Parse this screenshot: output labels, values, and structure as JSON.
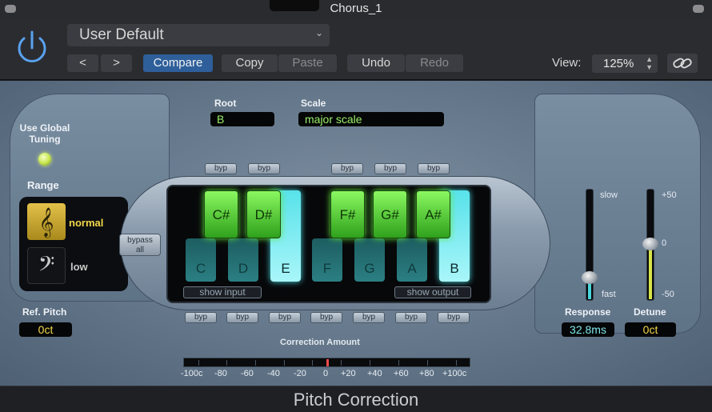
{
  "window": {
    "title": "Chorus_1"
  },
  "toolbar": {
    "preset": "User Default",
    "back_label": "<",
    "forward_label": ">",
    "compare_label": "Compare",
    "copy_label": "Copy",
    "paste_label": "Paste",
    "undo_label": "Undo",
    "redo_label": "Redo",
    "view_label": "View:",
    "zoom_value": "125%",
    "icons": {
      "power": "power-icon",
      "link": "link-icon",
      "dropdown": "chevron-down-icon"
    }
  },
  "plugin": {
    "name": "Pitch Correction",
    "root_label": "Root",
    "root_value": "B",
    "scale_label": "Scale",
    "scale_value": "major scale",
    "global_tuning_line1": "Use Global",
    "global_tuning_line2": "Tuning",
    "global_tuning_on": true,
    "range_label": "Range",
    "range_normal": "normal",
    "range_low": "low",
    "range_selected": "normal",
    "treble_clef": "𝄞",
    "bass_clef": "𝄢",
    "ref_pitch_label": "Ref. Pitch",
    "ref_pitch_value": "0ct",
    "bypass_all_line1": "bypass",
    "bypass_all_line2": "all",
    "bypass_label": "byp",
    "show_input": "show input",
    "show_output": "show output",
    "keys_white": [
      "C",
      "D",
      "E",
      "F",
      "G",
      "A",
      "B"
    ],
    "keys_black": [
      "C#",
      "D#",
      "F#",
      "G#",
      "A#"
    ],
    "lit_white_keys": [
      "E",
      "B"
    ],
    "correction_amount_label": "Correction Amount",
    "correction_scale": [
      "-100c",
      "-80",
      "-60",
      "-40",
      "-20",
      "0",
      "+20",
      "+40",
      "+60",
      "+80",
      "+100c"
    ],
    "response_label": "Response",
    "response_value": "32.8ms",
    "response_slow": "slow",
    "response_fast": "fast",
    "detune_label": "Detune",
    "detune_value": "0ct",
    "detune_max": "+50",
    "detune_mid": "0",
    "detune_min": "-50",
    "colors": {
      "lcd_green": "#9af06a",
      "lcd_yellow": "#f1d84a",
      "lcd_cyan": "#7fe6ea",
      "key_green": "#60e83a",
      "key_cyan": "#4ee0e6"
    }
  }
}
